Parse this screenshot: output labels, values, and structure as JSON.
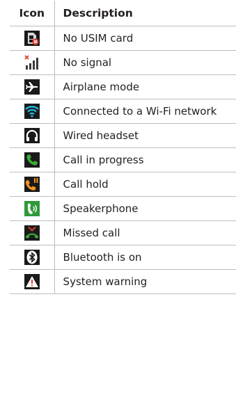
{
  "table": {
    "header": {
      "icon": "Icon",
      "description": "Description"
    },
    "rows": [
      {
        "icon": "no-usim-card-icon",
        "description": "No USIM card"
      },
      {
        "icon": "no-signal-icon",
        "description": "No signal"
      },
      {
        "icon": "airplane-mode-icon",
        "description": "Airplane mode"
      },
      {
        "icon": "wifi-icon",
        "description": "Connected to a Wi-Fi network"
      },
      {
        "icon": "wired-headset-icon",
        "description": "Wired headset"
      },
      {
        "icon": "call-in-progress-icon",
        "description": "Call in progress"
      },
      {
        "icon": "call-hold-icon",
        "description": "Call hold"
      },
      {
        "icon": "speakerphone-icon",
        "description": "Speakerphone"
      },
      {
        "icon": "missed-call-icon",
        "description": "Missed call"
      },
      {
        "icon": "bluetooth-icon",
        "description": "Bluetooth is on"
      },
      {
        "icon": "system-warning-icon",
        "description": "System warning"
      }
    ]
  },
  "colors": {
    "icon_dark_bg": "#1a1a1a",
    "call_green": "#3aaa35",
    "speaker_green": "#2f9a3a",
    "alert_red": "#e03c31",
    "wifi_cyan": "#1fb5e0",
    "hold_orange": "#f7941d"
  }
}
